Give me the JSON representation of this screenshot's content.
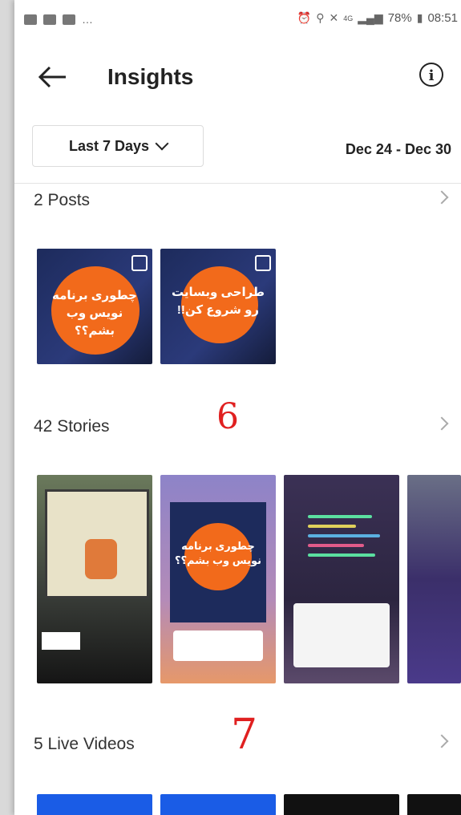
{
  "status_bar": {
    "battery": "78%",
    "time": "08:51",
    "network": "4G"
  },
  "header": {
    "title": "Insights",
    "back_icon": "arrow-left-icon",
    "info_icon": "info-icon"
  },
  "filter": {
    "range_label": "Last 7 Days",
    "date_range": "Dec 24 - Dec 30"
  },
  "sections": {
    "posts": {
      "label": "2 Posts",
      "items": [
        {
          "text": "چطوری برنامه نویس وب بشم؟؟"
        },
        {
          "text": "طراحی وبسایت رو شروع کن!!"
        }
      ]
    },
    "stories": {
      "label": "42 Stories",
      "annotation": "6",
      "items": [
        {
          "text": ""
        },
        {
          "text": "چطوری برنامه نویس وب بشم؟؟"
        },
        {
          "text": ""
        },
        {
          "text": ""
        }
      ]
    },
    "live": {
      "label": "5 Live Videos",
      "annotation": "7"
    }
  },
  "colors": {
    "accent_orange": "#f26a1b",
    "live_blue": "#1a5ce6",
    "annotation_red": "#e02020"
  }
}
